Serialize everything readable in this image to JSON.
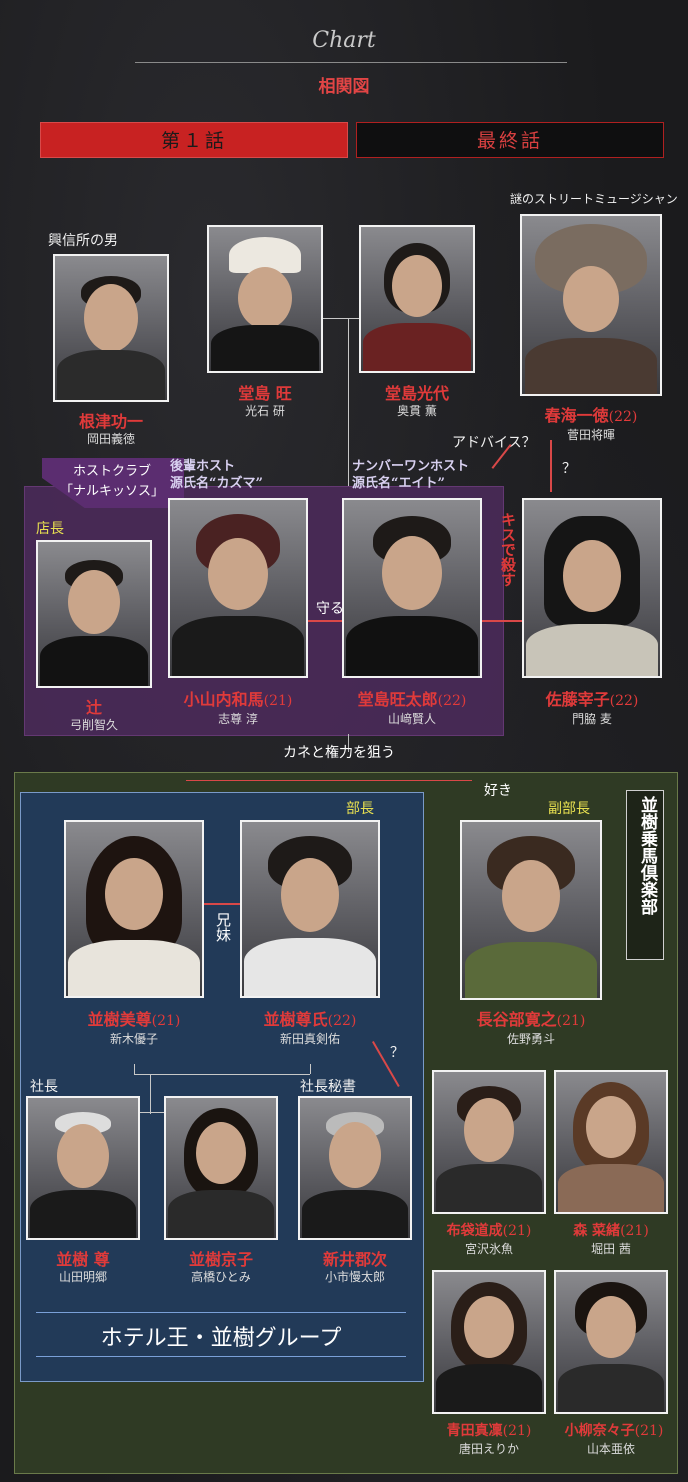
{
  "header": {
    "chart_script": "Chart",
    "subtitle": "相関図",
    "tabs": [
      {
        "label": "第１話",
        "active": true
      },
      {
        "label": "最終話",
        "active": false
      }
    ]
  },
  "groups": {
    "host_club": "ホストクラブ\n「ナルキッソス」",
    "riding_club": "並樹乗馬倶楽部",
    "hotel_group": "ホテル王・並樹グループ"
  },
  "relations": {
    "protect": "守る",
    "kiss_kill": "キスで殺す",
    "advice": "アドバイス？",
    "q1": "？",
    "money_power": "カネと権力を狙う",
    "like": "好き",
    "siblings": "兄妹",
    "q2": "？"
  },
  "people": {
    "nezu": {
      "role": "興信所の男",
      "name": "根津功一",
      "age": "",
      "actor": "岡田義徳"
    },
    "dojima_o": {
      "role": "",
      "name": "堂島 旺",
      "age": "",
      "actor": "光石 研"
    },
    "dojima_m": {
      "role": "",
      "name": "堂島光代",
      "age": "",
      "actor": "奥貫 薫"
    },
    "harumi": {
      "role": "謎のストリートミュージシャン",
      "name": "春海一徳",
      "age": "(22)",
      "actor": "菅田将暉"
    },
    "tsuji": {
      "role": "店長",
      "name": "辻",
      "age": "",
      "actor": "弓削智久"
    },
    "koyamauchi": {
      "role": "後輩ホスト\n源氏名“カズマ”",
      "name": "小山内和馬",
      "age": "(21)",
      "actor": "志尊 淳"
    },
    "dojima_k": {
      "role": "ナンバーワンホスト\n源氏名“エイト”",
      "name": "堂島旺太郎",
      "age": "(22)",
      "actor": "山﨑賢人"
    },
    "sato": {
      "role": "",
      "name": "佐藤宰子",
      "age": "(22)",
      "actor": "門脇 麦"
    },
    "namiki_mi": {
      "role": "",
      "name": "並樹美尊",
      "age": "(21)",
      "actor": "新木優子"
    },
    "namiki_s": {
      "role": "部長",
      "name": "並樹尊氏",
      "age": "(22)",
      "actor": "新田真剣佑"
    },
    "hasebe": {
      "role": "副部長",
      "name": "長谷部寛之",
      "age": "(21)",
      "actor": "佐野勇斗"
    },
    "namiki_t": {
      "role": "社長",
      "name": "並樹 尊",
      "age": "",
      "actor": "山田明郷"
    },
    "namiki_k": {
      "role": "",
      "name": "並樹京子",
      "age": "",
      "actor": "高橋ひとみ"
    },
    "arai": {
      "role": "社長秘書",
      "name": "新井郡次",
      "age": "",
      "actor": "小市慢太郎"
    },
    "hotei": {
      "role": "",
      "name": "布袋道成",
      "age": "(21)",
      "actor": "宮沢氷魚"
    },
    "mori": {
      "role": "",
      "name": "森 菜緒",
      "age": "(21)",
      "actor": "堀田 茜"
    },
    "aota": {
      "role": "",
      "name": "青田真凜",
      "age": "(21)",
      "actor": "唐田えりか"
    },
    "koyanagi": {
      "role": "",
      "name": "小柳奈々子",
      "age": "(21)",
      "actor": "山本亜依"
    }
  },
  "colors": {
    "accent_red": "#e03a3a",
    "host_purple": "#4a2a58",
    "hotel_blue": "#223a58",
    "club_green": "#3a4a2a"
  }
}
